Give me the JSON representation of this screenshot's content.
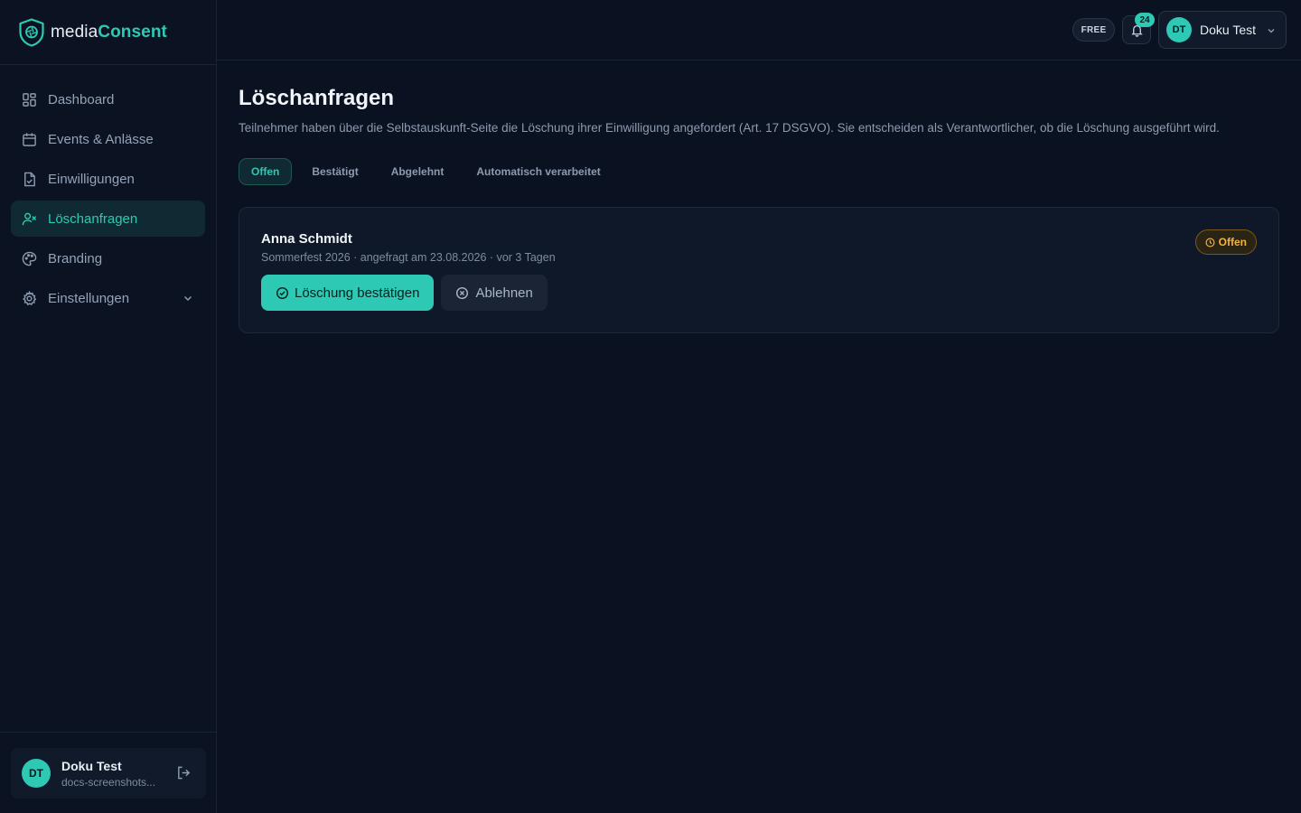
{
  "brand": {
    "name_part1": "media",
    "name_part2": "Consent"
  },
  "sidebar": {
    "items": [
      {
        "label": "Dashboard"
      },
      {
        "label": "Events & Anlässe"
      },
      {
        "label": "Einwilligungen"
      },
      {
        "label": "Löschanfragen"
      },
      {
        "label": "Branding"
      },
      {
        "label": "Einstellungen"
      }
    ]
  },
  "user": {
    "initials": "DT",
    "name": "Doku Test",
    "email": "docs-screenshots..."
  },
  "topbar": {
    "plan": "FREE",
    "notifications": "24"
  },
  "page": {
    "title": "Löschanfragen",
    "description": "Teilnehmer haben über die Selbstauskunft-Seite die Löschung ihrer Einwilligung angefordert (Art. 17 DSGVO). Sie entscheiden als Verantwortlicher, ob die Löschung ausgeführt wird."
  },
  "tabs": [
    {
      "label": "Offen"
    },
    {
      "label": "Bestätigt"
    },
    {
      "label": "Abgelehnt"
    },
    {
      "label": "Automatisch verarbeitet"
    }
  ],
  "requests": [
    {
      "name": "Anna Schmidt",
      "meta": "Sommerfest 2026 · angefragt am 23.08.2026 · vor 3 Tagen",
      "status": "Offen",
      "confirm_label": "Löschung bestätigen",
      "reject_label": "Ablehnen"
    }
  ],
  "colors": {
    "accent": "#2ec9b4",
    "background": "#0a1120",
    "warning": "#f5b43a"
  }
}
